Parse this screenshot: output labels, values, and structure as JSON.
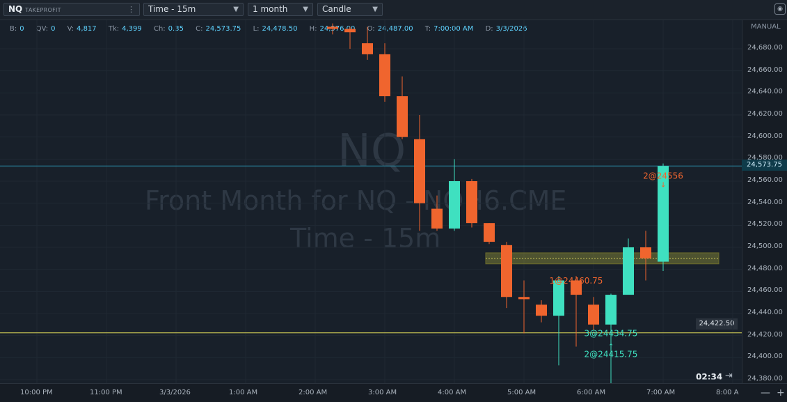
{
  "toolbar": {
    "symbol": "NQ",
    "account": "TAKEPROFIT",
    "more": "⋮",
    "timeframe": "Time - 15m",
    "range": "1 month",
    "chart_type": "Candle"
  },
  "info": {
    "B": "0",
    "QV": "0",
    "V": "4,817",
    "Tk": "4,399",
    "Ch": "0.35",
    "C": "24,573.75",
    "L": "24,478.50",
    "H": "24,576.00",
    "O": "24,487.00",
    "T": "7:00:00 AM",
    "D": "3/3/2026"
  },
  "watermark": {
    "symbol": "NQ",
    "description": "Front Month for NQ - NQH6.CME",
    "timeframe": "Time - 15m"
  },
  "price_axis": {
    "mode": "MANUAL",
    "last_price": "24,573.75",
    "level_label": "24,422.50"
  },
  "countdown": "02:34",
  "zoom": {
    "out": "—",
    "in": "+"
  },
  "colors": {
    "up": "#3fe0c0",
    "down": "#f0652e",
    "level": "#e6e05a",
    "last": "#2a8ca8"
  },
  "chart_data": {
    "type": "candlestick",
    "symbol": "NQ",
    "y_ticks": [
      24380,
      24400,
      24420,
      24440,
      24460,
      24480,
      24500,
      24520,
      24540,
      24560,
      24580,
      24600,
      24620,
      24640,
      24660,
      24680
    ],
    "y_tick_labels": [
      "24,380.00",
      "24,400.00",
      "24,420.00",
      "24,440.00",
      "24,460.00",
      "24,480.00",
      "24,500.00",
      "24,520.00",
      "24,540.00",
      "24,560.00",
      "24,580.00",
      "24,600.00",
      "24,620.00",
      "24,640.00",
      "24,660.00",
      "24,680.00"
    ],
    "ylim": [
      24370,
      24697
    ],
    "x_ticks": [
      {
        "label": "10:00 PM",
        "t": "22:00"
      },
      {
        "label": "11:00 PM",
        "t": "23:00"
      },
      {
        "label": "3/3/2026",
        "t": "00:00"
      },
      {
        "label": "1:00 AM",
        "t": "01:00"
      },
      {
        "label": "2:00 AM",
        "t": "02:00"
      },
      {
        "label": "3:00 AM",
        "t": "03:00"
      },
      {
        "label": "4:00 AM",
        "t": "04:00"
      },
      {
        "label": "5:00 AM",
        "t": "05:00"
      },
      {
        "label": "6:00 AM",
        "t": "06:00"
      },
      {
        "label": "7:00 AM",
        "t": "07:00"
      },
      {
        "label": "8:00 A",
        "t": "08:00"
      }
    ],
    "candles": [
      {
        "t": "02:15",
        "o": 24700,
        "h": 24703,
        "l": 24693,
        "c": 24698
      },
      {
        "t": "02:30",
        "o": 24698,
        "h": 24700,
        "l": 24680,
        "c": 24695
      },
      {
        "t": "02:45",
        "o": 24685,
        "h": 24700,
        "l": 24670,
        "c": 24675
      },
      {
        "t": "03:00",
        "o": 24675,
        "h": 24685,
        "l": 24632,
        "c": 24637
      },
      {
        "t": "03:15",
        "o": 24637,
        "h": 24655,
        "l": 24598,
        "c": 24600
      },
      {
        "t": "03:30",
        "o": 24598,
        "h": 24620,
        "l": 24515,
        "c": 24540
      },
      {
        "t": "03:45",
        "o": 24535,
        "h": 24547,
        "l": 24515,
        "c": 24517
      },
      {
        "t": "04:00",
        "o": 24517,
        "h": 24580,
        "l": 24515,
        "c": 24560
      },
      {
        "t": "04:15",
        "o": 24560,
        "h": 24562,
        "l": 24518,
        "c": 24522
      },
      {
        "t": "04:30",
        "o": 24522,
        "h": 24522,
        "l": 24503,
        "c": 24505
      },
      {
        "t": "04:45",
        "o": 24502,
        "h": 24505,
        "l": 24445,
        "c": 24455
      },
      {
        "t": "05:00",
        "o": 24455,
        "h": 24470,
        "l": 24422,
        "c": 24453
      },
      {
        "t": "05:15",
        "o": 24448,
        "h": 24452,
        "l": 24432,
        "c": 24438
      },
      {
        "t": "05:30",
        "o": 24438,
        "h": 24474,
        "l": 24393,
        "c": 24470
      },
      {
        "t": "05:45",
        "o": 24470,
        "h": 24474,
        "l": 24410,
        "c": 24457
      },
      {
        "t": "06:00",
        "o": 24448,
        "h": 24455,
        "l": 24425,
        "c": 24430
      },
      {
        "t": "06:15",
        "o": 24430,
        "h": 24458,
        "l": 24376,
        "c": 24457
      },
      {
        "t": "06:30",
        "o": 24457,
        "h": 24508,
        "l": 24458,
        "c": 24500
      },
      {
        "t": "06:45",
        "o": 24500,
        "h": 24515,
        "l": 24470,
        "c": 24490
      },
      {
        "t": "07:00",
        "o": 24487,
        "h": 24576,
        "l": 24478.5,
        "c": 24573.75
      }
    ],
    "horizontal_lines": [
      {
        "price": 24573.75,
        "kind": "last"
      },
      {
        "price": 24422.5,
        "kind": "level"
      }
    ],
    "zone": {
      "from_t": "04:30",
      "to_t": "07:45",
      "low": 24485,
      "high": 24495
    },
    "fills": [
      {
        "label": "2@24556",
        "t": "07:00",
        "price": 24556,
        "side": "sell"
      },
      {
        "label": "1@24460.75",
        "t": "05:45",
        "price": 24460.75,
        "side": "sell"
      },
      {
        "label": "3@24434.75",
        "t": "06:15",
        "price": 24434.75,
        "side": "buy"
      },
      {
        "label": "2@24415.75",
        "t": "06:15",
        "price": 24415.75,
        "side": "buy"
      }
    ]
  }
}
